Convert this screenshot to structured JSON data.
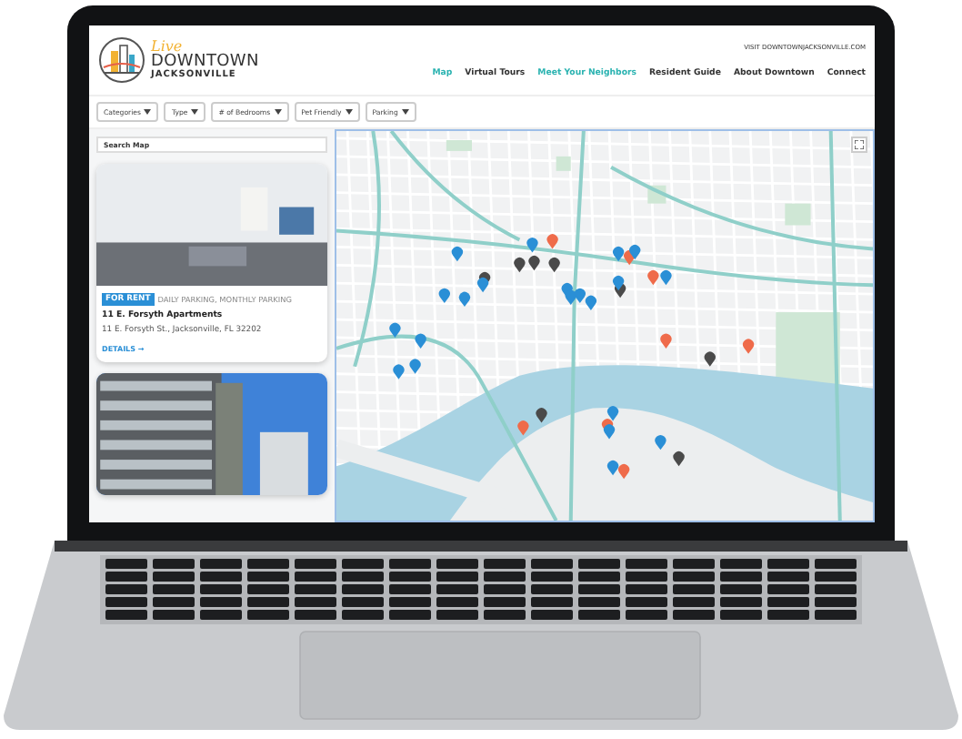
{
  "header": {
    "logo": {
      "script": "Live",
      "line1": "DOWNTOWN",
      "line2": "JACKSONVILLE"
    },
    "top_link": "VISIT DOWNTOWNJACKSONVILLE.COM",
    "nav": [
      {
        "label": "Map",
        "selected": true
      },
      {
        "label": "Virtual Tours",
        "selected": false
      },
      {
        "label": "Meet Your Neighbors",
        "selected": true
      },
      {
        "label": "Resident Guide",
        "selected": false
      },
      {
        "label": "About Downtown",
        "selected": false
      },
      {
        "label": "Connect",
        "selected": false
      }
    ]
  },
  "filters": [
    {
      "label": "Categories"
    },
    {
      "label": "Type"
    },
    {
      "label": "# of Bedrooms"
    },
    {
      "label": "Pet Friendly"
    },
    {
      "label": "Parking"
    }
  ],
  "search": {
    "placeholder": "Search Map"
  },
  "listings": [
    {
      "kind": "full",
      "badge": "FOR RENT",
      "tags": "DAILY PARKING, MONTHLY PARKING",
      "name": "11 E. Forsyth Apartments",
      "address": "11 E. Forsyth St., Jacksonville, FL 32202",
      "link": "DETAILS →"
    },
    {
      "kind": "photo"
    }
  ]
}
